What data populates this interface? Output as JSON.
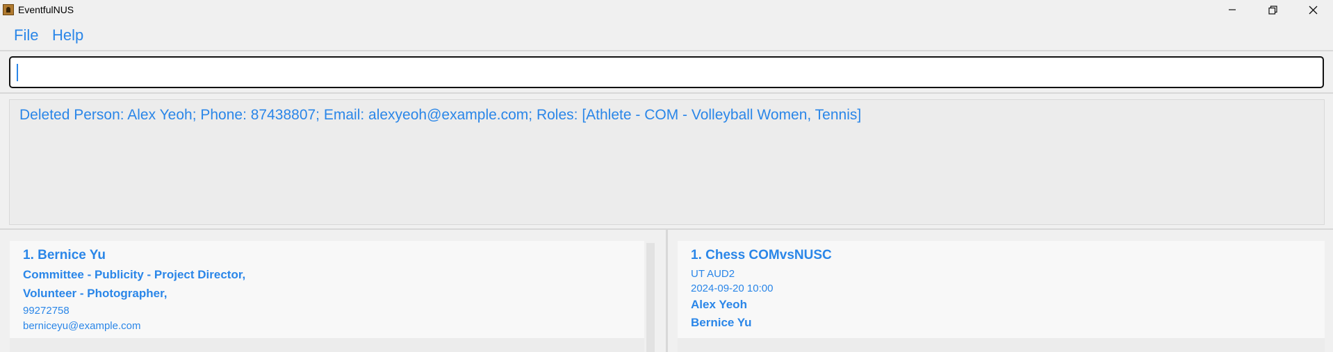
{
  "window": {
    "title": "EventfulNUS",
    "minimize_icon": "minimize-icon",
    "restore_icon": "restore-icon",
    "close_icon": "close-icon"
  },
  "menu": {
    "file": "File",
    "help": "Help"
  },
  "command_box": {
    "value": ""
  },
  "result_display": {
    "text": "Deleted Person: Alex Yeoh; Phone: 87438807; Email: alexyeoh@example.com; Roles: [Athlete - COM - Volleyball Women, Tennis]"
  },
  "persons": [
    {
      "name": "1. Bernice Yu",
      "roles": [
        "Committee - Publicity - Project Director,",
        "Volunteer - Photographer,"
      ],
      "phone": "99272758",
      "email": "berniceyu@example.com"
    }
  ],
  "events": [
    {
      "name": "1. Chess COMvsNUSC",
      "venue": "UT AUD2",
      "datetime": "2024-09-20 10:00",
      "participants": [
        "Alex Yeoh",
        "Bernice Yu"
      ]
    }
  ],
  "colors": {
    "accent": "#2a86e8",
    "background": "#f0f0f0",
    "card": "#f8f8f8"
  }
}
